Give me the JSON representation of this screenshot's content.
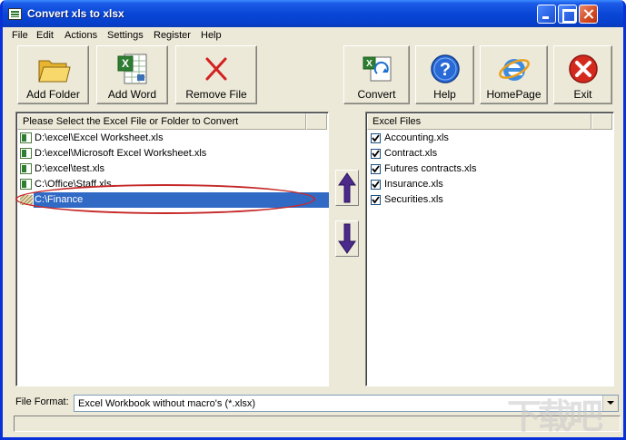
{
  "window": {
    "title": "Convert xls to xlsx"
  },
  "menu": [
    "File",
    "Edit",
    "Actions",
    "Settings",
    "Register",
    "Help"
  ],
  "toolbar": {
    "add_folder": "Add Folder",
    "add_word": "Add Word",
    "remove_file": "Remove File",
    "convert": "Convert",
    "help": "Help",
    "homepage": "HomePage",
    "exit": "Exit"
  },
  "left_panel": {
    "header": "Please Select the Excel File or Folder to Convert",
    "items": [
      {
        "label": "D:\\excel\\Excel Worksheet.xls",
        "type": "file"
      },
      {
        "label": "D:\\excel\\Microsoft Excel Worksheet.xls",
        "type": "file"
      },
      {
        "label": "D:\\excel\\test.xls",
        "type": "file"
      },
      {
        "label": "C:\\Office\\Staff.xls",
        "type": "file"
      },
      {
        "label": "C:\\Finance",
        "type": "folder",
        "selected": true
      }
    ]
  },
  "right_panel": {
    "header": "Excel Files",
    "items": [
      {
        "label": "Accounting.xls",
        "checked": true
      },
      {
        "label": "Contract.xls",
        "checked": true
      },
      {
        "label": "Futures contracts.xls",
        "checked": true
      },
      {
        "label": "Insurance.xls",
        "checked": true
      },
      {
        "label": "Securities.xls",
        "checked": true
      }
    ]
  },
  "file_format": {
    "label": "File Format:",
    "value": "Excel Workbook without macro's (*.xlsx)"
  },
  "colors": {
    "titlebar": "#0A47D6",
    "selection": "#316AC5",
    "annotation": "#C62828",
    "arrow": "#4B2A8C"
  }
}
